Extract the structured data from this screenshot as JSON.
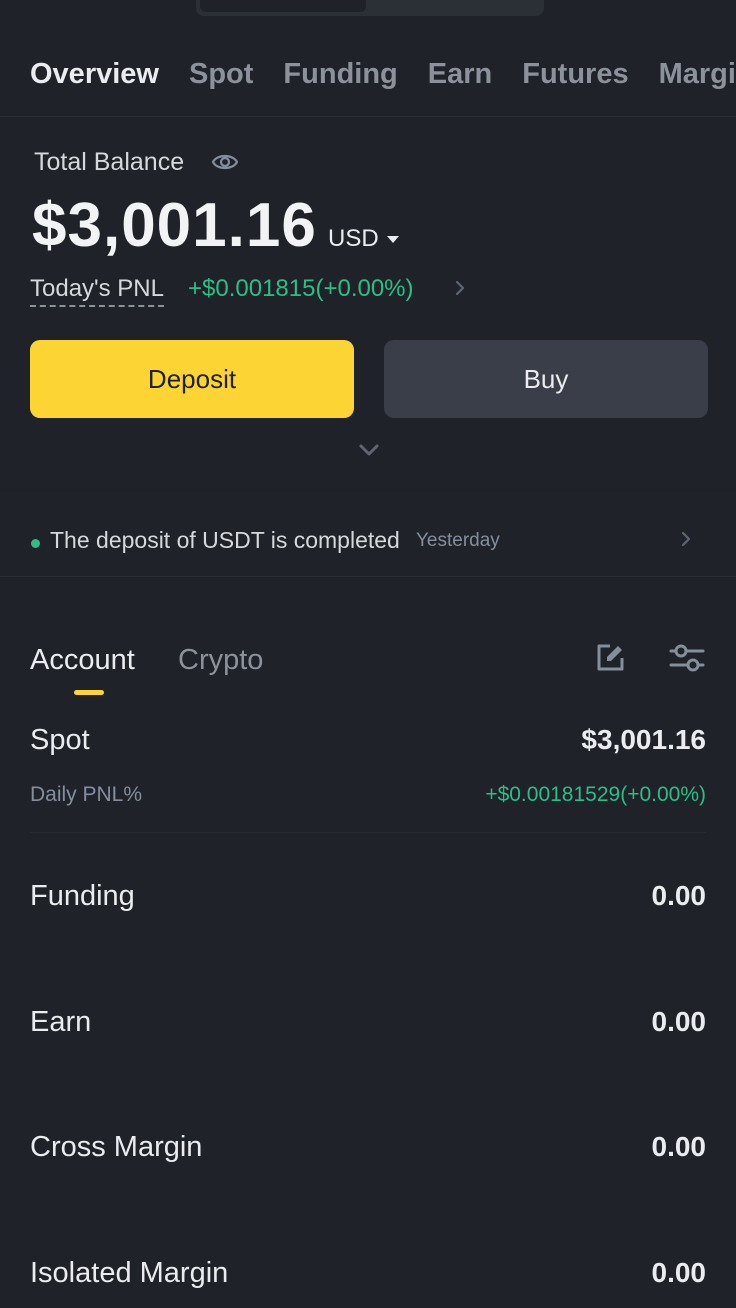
{
  "tabs": [
    "Overview",
    "Spot",
    "Funding",
    "Earn",
    "Futures",
    "Margin"
  ],
  "balance": {
    "label": "Total Balance",
    "amount": "$3,001.16",
    "currency": "USD",
    "pnl_label": "Today's PNL",
    "pnl_value": "+$0.001815(+0.00%)"
  },
  "buttons": {
    "deposit": "Deposit",
    "buy": "Buy"
  },
  "notice": {
    "text": "The deposit of USDT is completed",
    "time": "Yesterday"
  },
  "section_tabs": {
    "account": "Account",
    "crypto": "Crypto"
  },
  "accounts": [
    {
      "label": "Spot",
      "value": "$3,001.16",
      "sub_label": "Daily PNL%",
      "sub_value": "+$0.00181529(+0.00%)"
    },
    {
      "label": "Funding",
      "value": "0.00"
    },
    {
      "label": "Earn",
      "value": "0.00"
    },
    {
      "label": "Cross Margin",
      "value": "0.00"
    },
    {
      "label": "Isolated Margin",
      "value": "0.00"
    }
  ],
  "colors": {
    "background": "#1f2229",
    "accent_yellow": "#fcd535",
    "positive_green": "#2ebd85",
    "muted_text": "#848e9c"
  }
}
